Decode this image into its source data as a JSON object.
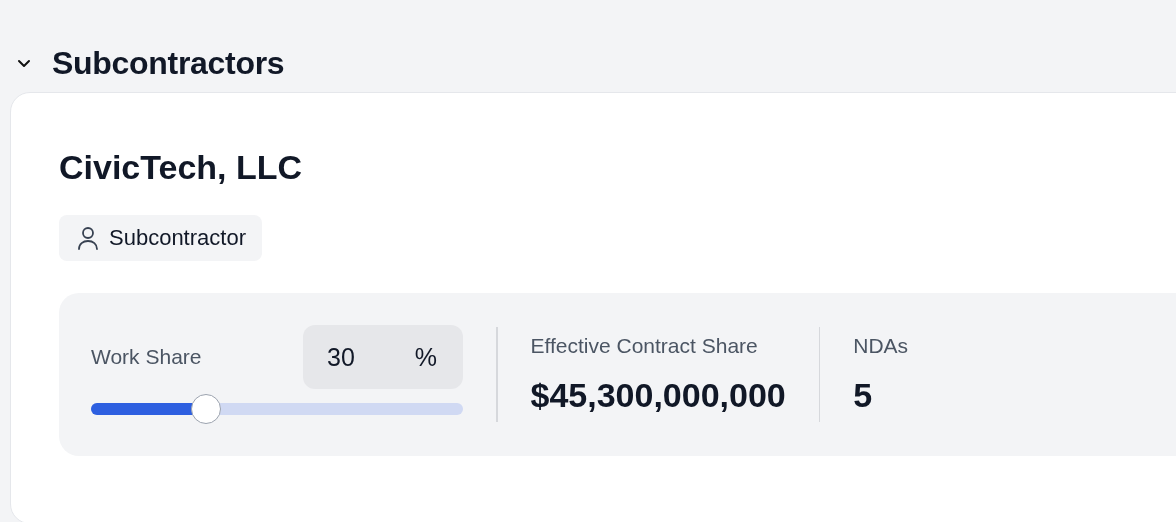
{
  "section": {
    "title": "Subcontractors",
    "expanded": true
  },
  "card": {
    "name": "CivicTech, LLC",
    "role": "Subcontractor",
    "work_share": {
      "label": "Work Share",
      "value": "30",
      "unit": "%",
      "level": 0.31
    },
    "stats": [
      {
        "label": "Effective Contract Share",
        "value": "$45,300,000,000"
      },
      {
        "label": "NDAs",
        "value": "5"
      }
    ]
  }
}
